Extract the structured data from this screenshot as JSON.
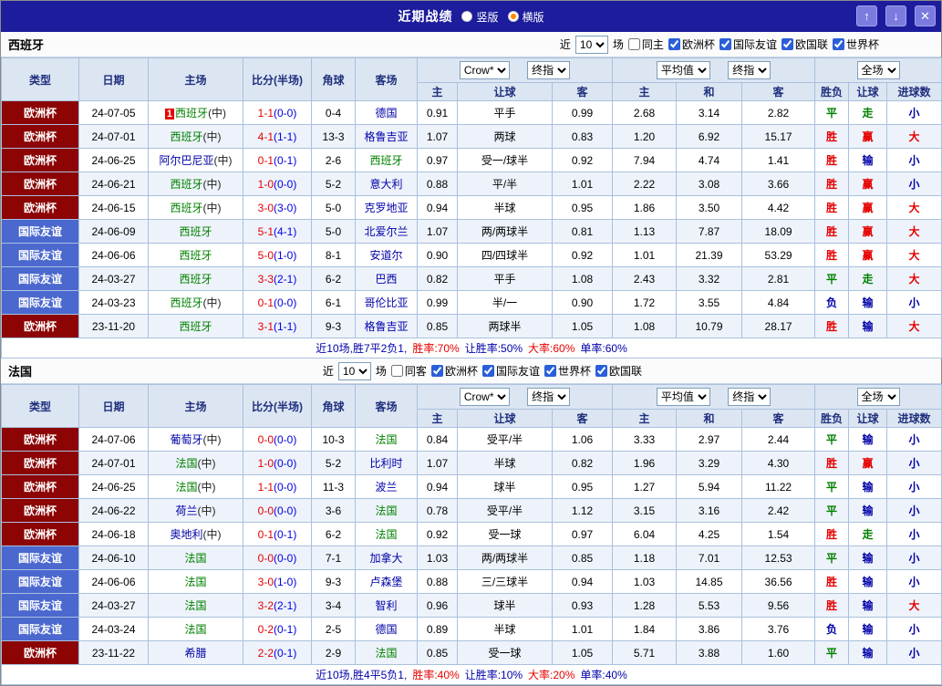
{
  "topbar": {
    "title": "近期战绩",
    "radio_vertical": "竖版",
    "radio_horizontal": "横版",
    "selected": "横版",
    "up_icon": "↑",
    "down_icon": "↓",
    "close_icon": "✕"
  },
  "colors": {
    "topbar_bg": "#1C1C9C",
    "euro_bg": "#8C0404",
    "friendly_bg": "#4B68CF",
    "win_red": "#E60000",
    "draw_green": "#008000",
    "loss_navy": "#0000A8",
    "header_bg": "#DCE6F2"
  },
  "table": {
    "col_type": "类型",
    "col_date": "日期",
    "col_home": "主场",
    "col_score": "比分(半场)",
    "col_corner": "角球",
    "col_away": "客场",
    "crow_select": "Crow*",
    "final_select": "终指",
    "avg_select": "平均值",
    "final_select2": "终指",
    "full_select": "全场",
    "sub": [
      "主",
      "让球",
      "客",
      "主",
      "和",
      "客",
      "胜负",
      "让球",
      "进球数"
    ]
  },
  "sections": [
    {
      "team": "西班牙",
      "filter": {
        "near_label": "近",
        "count": "10",
        "games_label": "场",
        "same_label": "同主",
        "same_checked": false,
        "competitions": [
          {
            "label": "欧洲杯",
            "checked": true
          },
          {
            "label": "国际友谊",
            "checked": true
          },
          {
            "label": "欧国联",
            "checked": true
          },
          {
            "label": "世界杯",
            "checked": true
          }
        ]
      },
      "rows": [
        {
          "lg": "欧洲杯",
          "lgc": "euro",
          "date": "24-07-05",
          "badge": "1",
          "home": "西班牙",
          "hsuf": "(中)",
          "hc": "g",
          "score": "1-1",
          "half": "(0-0)",
          "corner": "0-4",
          "away": "德国",
          "ac": "n",
          "o": [
            "0.91",
            "平手",
            "0.99"
          ],
          "avg": [
            "2.68",
            "3.14",
            "2.82"
          ],
          "res": "平",
          "resc": "g",
          "hres": "走",
          "hresc": "g",
          "goal": "小",
          "goalc": "n"
        },
        {
          "lg": "欧洲杯",
          "lgc": "euro",
          "date": "24-07-01",
          "badge": "",
          "home": "西班牙",
          "hsuf": "(中)",
          "hc": "g",
          "score": "4-1",
          "half": "(1-1)",
          "corner": "13-3",
          "away": "格鲁吉亚",
          "ac": "n",
          "o": [
            "1.07",
            "两球",
            "0.83"
          ],
          "avg": [
            "1.20",
            "6.92",
            "15.17"
          ],
          "res": "胜",
          "resc": "r",
          "hres": "赢",
          "hresc": "r",
          "goal": "大",
          "goalc": "r"
        },
        {
          "lg": "欧洲杯",
          "lgc": "euro",
          "date": "24-06-25",
          "badge": "",
          "home": "阿尔巴尼亚",
          "hsuf": "(中)",
          "hc": "n",
          "score": "0-1",
          "half": "(0-1)",
          "corner": "2-6",
          "away": "西班牙",
          "ac": "g",
          "o": [
            "0.97",
            "受一/球半",
            "0.92"
          ],
          "avg": [
            "7.94",
            "4.74",
            "1.41"
          ],
          "res": "胜",
          "resc": "r",
          "hres": "输",
          "hresc": "n",
          "goal": "小",
          "goalc": "n"
        },
        {
          "lg": "欧洲杯",
          "lgc": "euro",
          "date": "24-06-21",
          "badge": "",
          "home": "西班牙",
          "hsuf": "(中)",
          "hc": "g",
          "score": "1-0",
          "half": "(0-0)",
          "corner": "5-2",
          "away": "意大利",
          "ac": "n",
          "o": [
            "0.88",
            "平/半",
            "1.01"
          ],
          "avg": [
            "2.22",
            "3.08",
            "3.66"
          ],
          "res": "胜",
          "resc": "r",
          "hres": "赢",
          "hresc": "r",
          "goal": "小",
          "goalc": "n"
        },
        {
          "lg": "欧洲杯",
          "lgc": "euro",
          "date": "24-06-15",
          "badge": "",
          "home": "西班牙",
          "hsuf": "(中)",
          "hc": "g",
          "score": "3-0",
          "half": "(3-0)",
          "corner": "5-0",
          "away": "克罗地亚",
          "ac": "n",
          "o": [
            "0.94",
            "半球",
            "0.95"
          ],
          "avg": [
            "1.86",
            "3.50",
            "4.42"
          ],
          "res": "胜",
          "resc": "r",
          "hres": "赢",
          "hresc": "r",
          "goal": "大",
          "goalc": "r"
        },
        {
          "lg": "国际友谊",
          "lgc": "friendly",
          "date": "24-06-09",
          "badge": "",
          "home": "西班牙",
          "hsuf": "",
          "hc": "g",
          "score": "5-1",
          "half": "(4-1)",
          "corner": "5-0",
          "away": "北爱尔兰",
          "ac": "n",
          "o": [
            "1.07",
            "两/两球半",
            "0.81"
          ],
          "avg": [
            "1.13",
            "7.87",
            "18.09"
          ],
          "res": "胜",
          "resc": "r",
          "hres": "赢",
          "hresc": "r",
          "goal": "大",
          "goalc": "r"
        },
        {
          "lg": "国际友谊",
          "lgc": "friendly",
          "date": "24-06-06",
          "badge": "",
          "home": "西班牙",
          "hsuf": "",
          "hc": "g",
          "score": "5-0",
          "half": "(1-0)",
          "corner": "8-1",
          "away": "安道尔",
          "ac": "n",
          "o": [
            "0.90",
            "四/四球半",
            "0.92"
          ],
          "avg": [
            "1.01",
            "21.39",
            "53.29"
          ],
          "res": "胜",
          "resc": "r",
          "hres": "赢",
          "hresc": "r",
          "goal": "大",
          "goalc": "r"
        },
        {
          "lg": "国际友谊",
          "lgc": "friendly",
          "date": "24-03-27",
          "badge": "",
          "home": "西班牙",
          "hsuf": "",
          "hc": "g",
          "score": "3-3",
          "half": "(2-1)",
          "corner": "6-2",
          "away": "巴西",
          "ac": "n",
          "o": [
            "0.82",
            "平手",
            "1.08"
          ],
          "avg": [
            "2.43",
            "3.32",
            "2.81"
          ],
          "res": "平",
          "resc": "g",
          "hres": "走",
          "hresc": "g",
          "goal": "大",
          "goalc": "r"
        },
        {
          "lg": "国际友谊",
          "lgc": "friendly",
          "date": "24-03-23",
          "badge": "",
          "home": "西班牙",
          "hsuf": "(中)",
          "hc": "g",
          "score": "0-1",
          "half": "(0-0)",
          "corner": "6-1",
          "away": "哥伦比亚",
          "ac": "n",
          "o": [
            "0.99",
            "半/一",
            "0.90"
          ],
          "avg": [
            "1.72",
            "3.55",
            "4.84"
          ],
          "res": "负",
          "resc": "n",
          "hres": "输",
          "hresc": "n",
          "goal": "小",
          "goalc": "n"
        },
        {
          "lg": "欧洲杯",
          "lgc": "euro",
          "date": "23-11-20",
          "badge": "",
          "home": "西班牙",
          "hsuf": "",
          "hc": "g",
          "score": "3-1",
          "half": "(1-1)",
          "corner": "9-3",
          "away": "格鲁吉亚",
          "ac": "n",
          "o": [
            "0.85",
            "两球半",
            "1.05"
          ],
          "avg": [
            "1.08",
            "10.79",
            "28.17"
          ],
          "res": "胜",
          "resc": "r",
          "hres": "输",
          "hresc": "n",
          "goal": "大",
          "goalc": "r"
        }
      ],
      "summary": [
        {
          "t": "近10场,胜7平2负1,",
          "c": "n"
        },
        {
          "t": "胜率:70%",
          "c": "r"
        },
        {
          "t": "让胜率:50%",
          "c": "n"
        },
        {
          "t": "大率:60%",
          "c": "r"
        },
        {
          "t": "单率:60%",
          "c": "n"
        }
      ]
    },
    {
      "team": "法国",
      "filter": {
        "near_label": "近",
        "count": "10",
        "games_label": "场",
        "same_label": "同客",
        "same_checked": false,
        "competitions": [
          {
            "label": "欧洲杯",
            "checked": true
          },
          {
            "label": "国际友谊",
            "checked": true
          },
          {
            "label": "世界杯",
            "checked": true
          },
          {
            "label": "欧国联",
            "checked": true
          }
        ]
      },
      "rows": [
        {
          "lg": "欧洲杯",
          "lgc": "euro",
          "date": "24-07-06",
          "badge": "",
          "home": "葡萄牙",
          "hsuf": "(中)",
          "hc": "n",
          "score": "0-0",
          "half": "(0-0)",
          "corner": "10-3",
          "away": "法国",
          "ac": "g",
          "o": [
            "0.84",
            "受平/半",
            "1.06"
          ],
          "avg": [
            "3.33",
            "2.97",
            "2.44"
          ],
          "res": "平",
          "resc": "g",
          "hres": "输",
          "hresc": "n",
          "goal": "小",
          "goalc": "n"
        },
        {
          "lg": "欧洲杯",
          "lgc": "euro",
          "date": "24-07-01",
          "badge": "",
          "home": "法国",
          "hsuf": "(中)",
          "hc": "g",
          "score": "1-0",
          "half": "(0-0)",
          "corner": "5-2",
          "away": "比利时",
          "ac": "n",
          "o": [
            "1.07",
            "半球",
            "0.82"
          ],
          "avg": [
            "1.96",
            "3.29",
            "4.30"
          ],
          "res": "胜",
          "resc": "r",
          "hres": "赢",
          "hresc": "r",
          "goal": "小",
          "goalc": "n"
        },
        {
          "lg": "欧洲杯",
          "lgc": "euro",
          "date": "24-06-25",
          "badge": "",
          "home": "法国",
          "hsuf": "(中)",
          "hc": "g",
          "score": "1-1",
          "half": "(0-0)",
          "corner": "11-3",
          "away": "波兰",
          "ac": "n",
          "o": [
            "0.94",
            "球半",
            "0.95"
          ],
          "avg": [
            "1.27",
            "5.94",
            "11.22"
          ],
          "res": "平",
          "resc": "g",
          "hres": "输",
          "hresc": "n",
          "goal": "小",
          "goalc": "n"
        },
        {
          "lg": "欧洲杯",
          "lgc": "euro",
          "date": "24-06-22",
          "badge": "",
          "home": "荷兰",
          "hsuf": "(中)",
          "hc": "n",
          "score": "0-0",
          "half": "(0-0)",
          "corner": "3-6",
          "away": "法国",
          "ac": "g",
          "o": [
            "0.78",
            "受平/半",
            "1.12"
          ],
          "avg": [
            "3.15",
            "3.16",
            "2.42"
          ],
          "res": "平",
          "resc": "g",
          "hres": "输",
          "hresc": "n",
          "goal": "小",
          "goalc": "n"
        },
        {
          "lg": "欧洲杯",
          "lgc": "euro",
          "date": "24-06-18",
          "badge": "",
          "home": "奥地利",
          "hsuf": "(中)",
          "hc": "n",
          "score": "0-1",
          "half": "(0-1)",
          "corner": "6-2",
          "away": "法国",
          "ac": "g",
          "o": [
            "0.92",
            "受一球",
            "0.97"
          ],
          "avg": [
            "6.04",
            "4.25",
            "1.54"
          ],
          "res": "胜",
          "resc": "r",
          "hres": "走",
          "hresc": "g",
          "goal": "小",
          "goalc": "n"
        },
        {
          "lg": "国际友谊",
          "lgc": "friendly",
          "date": "24-06-10",
          "badge": "",
          "home": "法国",
          "hsuf": "",
          "hc": "g",
          "score": "0-0",
          "half": "(0-0)",
          "corner": "7-1",
          "away": "加拿大",
          "ac": "n",
          "o": [
            "1.03",
            "两/两球半",
            "0.85"
          ],
          "avg": [
            "1.18",
            "7.01",
            "12.53"
          ],
          "res": "平",
          "resc": "g",
          "hres": "输",
          "hresc": "n",
          "goal": "小",
          "goalc": "n"
        },
        {
          "lg": "国际友谊",
          "lgc": "friendly",
          "date": "24-06-06",
          "badge": "",
          "home": "法国",
          "hsuf": "",
          "hc": "g",
          "score": "3-0",
          "half": "(1-0)",
          "corner": "9-3",
          "away": "卢森堡",
          "ac": "n",
          "o": [
            "0.88",
            "三/三球半",
            "0.94"
          ],
          "avg": [
            "1.03",
            "14.85",
            "36.56"
          ],
          "res": "胜",
          "resc": "r",
          "hres": "输",
          "hresc": "n",
          "goal": "小",
          "goalc": "n"
        },
        {
          "lg": "国际友谊",
          "lgc": "friendly",
          "date": "24-03-27",
          "badge": "",
          "home": "法国",
          "hsuf": "",
          "hc": "g",
          "score": "3-2",
          "half": "(2-1)",
          "corner": "3-4",
          "away": "智利",
          "ac": "n",
          "o": [
            "0.96",
            "球半",
            "0.93"
          ],
          "avg": [
            "1.28",
            "5.53",
            "9.56"
          ],
          "res": "胜",
          "resc": "r",
          "hres": "输",
          "hresc": "n",
          "goal": "大",
          "goalc": "r"
        },
        {
          "lg": "国际友谊",
          "lgc": "friendly",
          "date": "24-03-24",
          "badge": "",
          "home": "法国",
          "hsuf": "",
          "hc": "g",
          "score": "0-2",
          "half": "(0-1)",
          "corner": "2-5",
          "away": "德国",
          "ac": "n",
          "o": [
            "0.89",
            "半球",
            "1.01"
          ],
          "avg": [
            "1.84",
            "3.86",
            "3.76"
          ],
          "res": "负",
          "resc": "n",
          "hres": "输",
          "hresc": "n",
          "goal": "小",
          "goalc": "n"
        },
        {
          "lg": "欧洲杯",
          "lgc": "euro",
          "date": "23-11-22",
          "badge": "",
          "home": "希腊",
          "hsuf": "",
          "hc": "n",
          "score": "2-2",
          "half": "(0-1)",
          "corner": "2-9",
          "away": "法国",
          "ac": "g",
          "o": [
            "0.85",
            "受一球",
            "1.05"
          ],
          "avg": [
            "5.71",
            "3.88",
            "1.60"
          ],
          "res": "平",
          "resc": "g",
          "hres": "输",
          "hresc": "n",
          "goal": "小",
          "goalc": "n"
        }
      ],
      "summary": [
        {
          "t": "近10场,胜4平5负1,",
          "c": "n"
        },
        {
          "t": "胜率:40%",
          "c": "r"
        },
        {
          "t": "让胜率:10%",
          "c": "n"
        },
        {
          "t": "大率:20%",
          "c": "r"
        },
        {
          "t": "单率:40%",
          "c": "n"
        }
      ]
    }
  ]
}
